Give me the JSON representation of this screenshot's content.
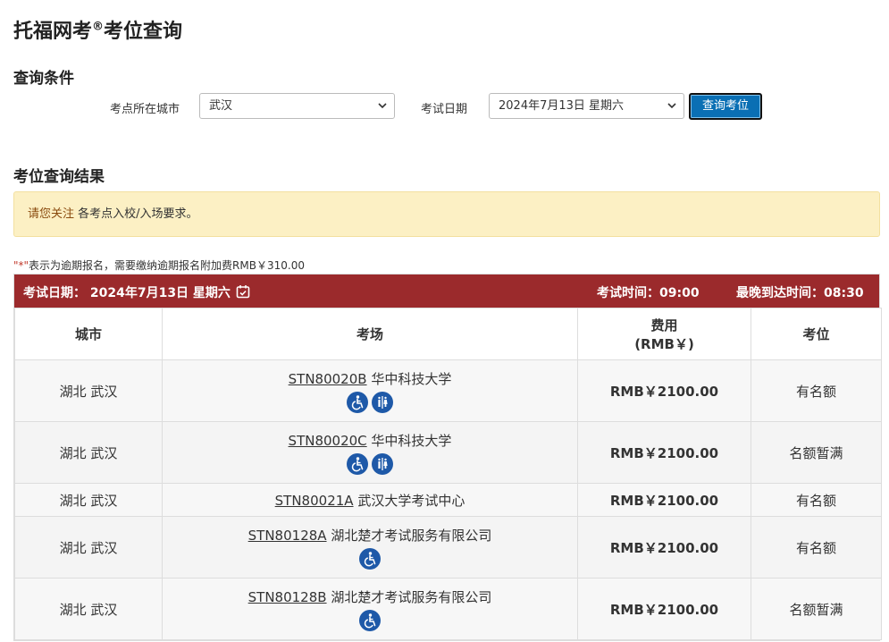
{
  "page": {
    "title": "托福网考",
    "title_sup": "®",
    "title_suffix": "考位查询"
  },
  "filters": {
    "section_title": "查询条件",
    "city_label": "考点所在城市",
    "city_value": "武汉",
    "date_label": "考试日期",
    "date_value": "2024年7月13日 星期六",
    "query_button": "查询考位"
  },
  "results": {
    "section_title": "考位查询结果",
    "notice_highlight": "请您关注",
    "notice_text": " 各考点入校/入场要求。",
    "footnote_mark": "\"*\"",
    "footnote_text": "表示为逾期报名，需要缴纳逾期报名附加费RMB￥310.00",
    "banner": {
      "date": "考试日期：  2024年7月13日 星期六",
      "exam_time": "考试时间：09:00",
      "latest_arrival": "最晚到达时间：08:30"
    },
    "columns": {
      "city": "城市",
      "venue": "考场",
      "fee_line1": "费用",
      "fee_line2": "(RMB￥)",
      "seat": "考位"
    },
    "rows": [
      {
        "city": "湖北 武汉",
        "code": "STN80020B",
        "name": " 华中科技大学",
        "fee": "RMB￥2100.00",
        "seat": "有名额",
        "icons": [
          "wheelchair-icon",
          "restroom-icon"
        ]
      },
      {
        "city": "湖北 武汉",
        "code": "STN80020C",
        "name": " 华中科技大学",
        "fee": "RMB￥2100.00",
        "seat": "名额暂满",
        "icons": [
          "wheelchair-icon",
          "restroom-icon"
        ]
      },
      {
        "city": "湖北 武汉",
        "code": "STN80021A",
        "name": " 武汉大学考试中心",
        "fee": "RMB￥2100.00",
        "seat": "有名额",
        "icons": []
      },
      {
        "city": "湖北 武汉",
        "code": "STN80128A",
        "name": " 湖北楚才考试服务有限公司",
        "fee": "RMB￥2100.00",
        "seat": "有名额",
        "icons": [
          "wheelchair-icon"
        ]
      },
      {
        "city": "湖北 武汉",
        "code": "STN80128B",
        "name": " 湖北楚才考试服务有限公司",
        "fee": "RMB￥2100.00",
        "seat": "名额暂满",
        "icons": [
          "wheelchair-icon"
        ]
      }
    ]
  },
  "colors": {
    "banner": "#9b2a2c",
    "button": "#0a6fb4",
    "notice_bg": "#fcf0c4",
    "icon_blue": "#1e59a8"
  }
}
